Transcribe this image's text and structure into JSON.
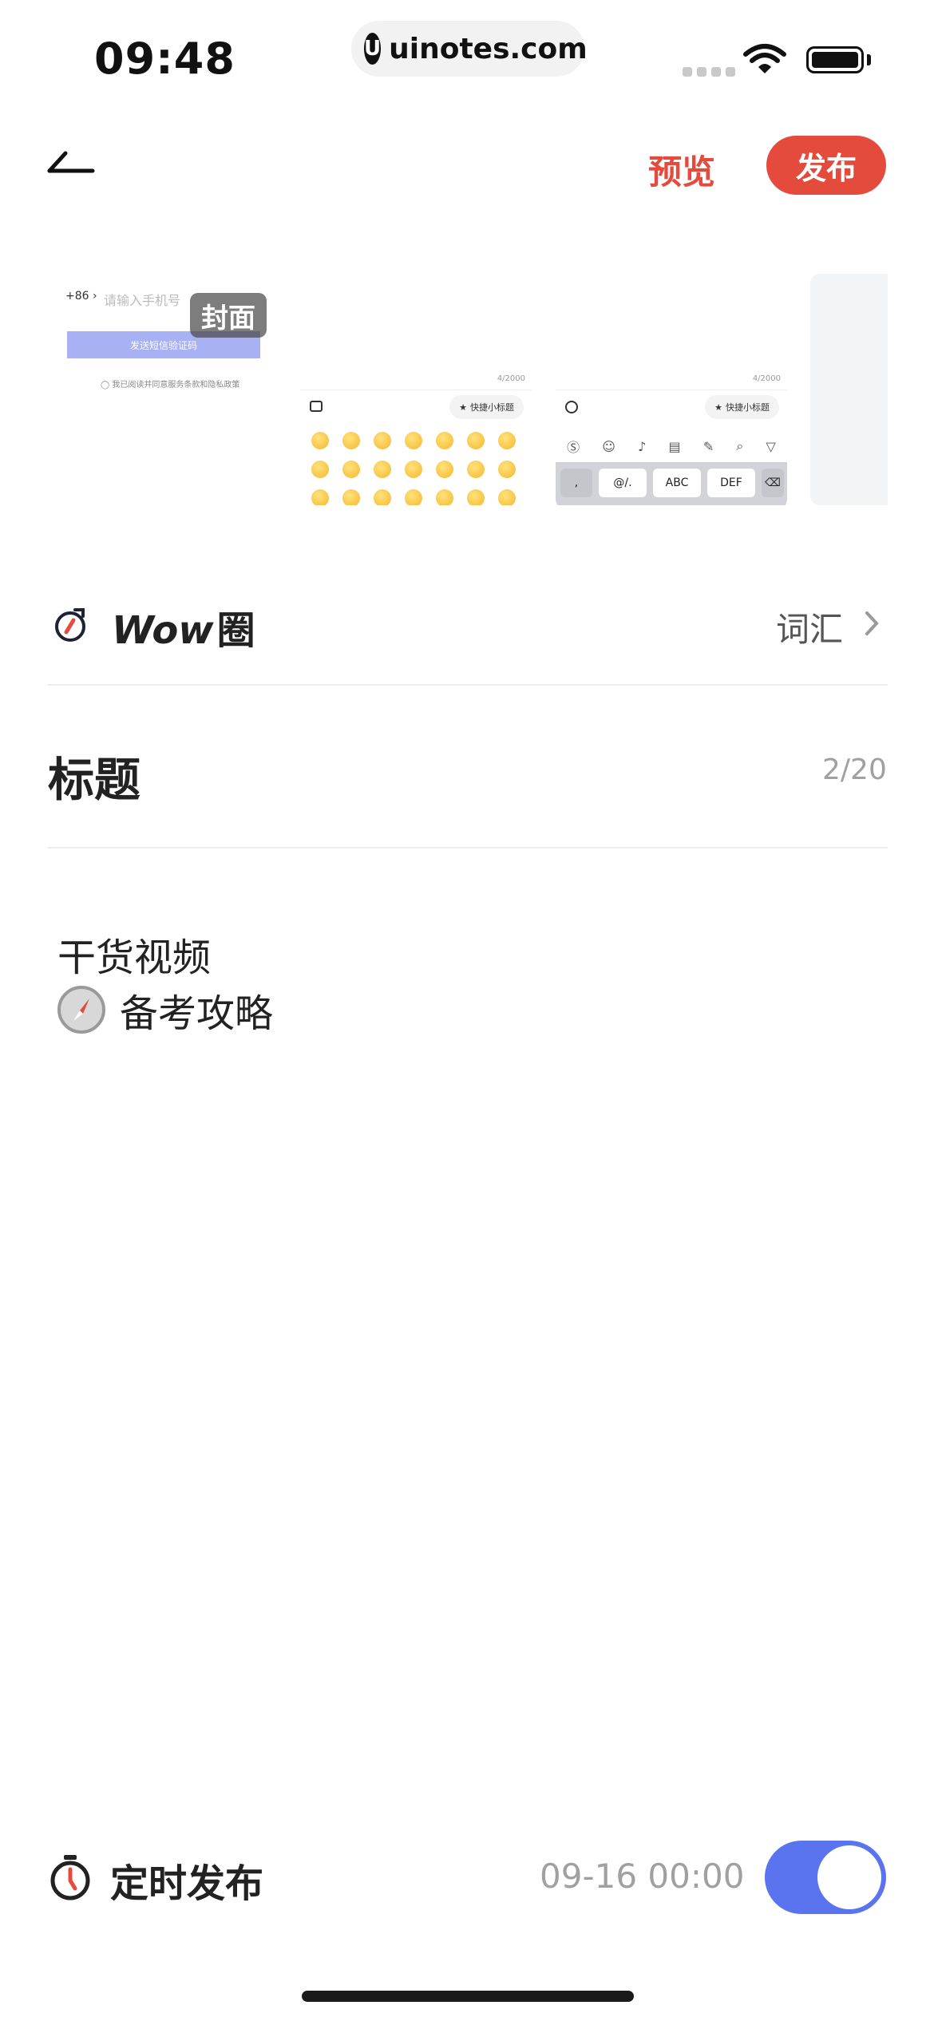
{
  "status_bar": {
    "time": "09:48",
    "url": "uinotes.com",
    "url_logo": "U"
  },
  "header": {
    "preview_label": "预览",
    "publish_label": "发布"
  },
  "thumbnails": {
    "cover_tag": "封面",
    "thumb1": {
      "country_code": "+86 ›",
      "phone_placeholder": "请输入手机号",
      "sms_button": "发送短信验证码",
      "agreement": "◯ 我已阅读并同意服务条款和隐私政策"
    },
    "char_count_small": "4/2000",
    "quick_subtitle": "快捷小标题",
    "keys": [
      ",",
      "@/.",
      "ABC",
      "DEF",
      "⌫"
    ]
  },
  "circle_row": {
    "title_italic": "Wow",
    "title_suffix": "圈",
    "value": "词汇"
  },
  "title_row": {
    "placeholder": "标题",
    "count": "2/20"
  },
  "body": {
    "line1": "干货视频",
    "line2": "备考攻略"
  },
  "schedule": {
    "label": "定时发布",
    "datetime": "09-16 00:00",
    "enabled": true
  },
  "colors": {
    "accent_red": "#e54b3c",
    "toggle_blue": "#5a74f0"
  }
}
